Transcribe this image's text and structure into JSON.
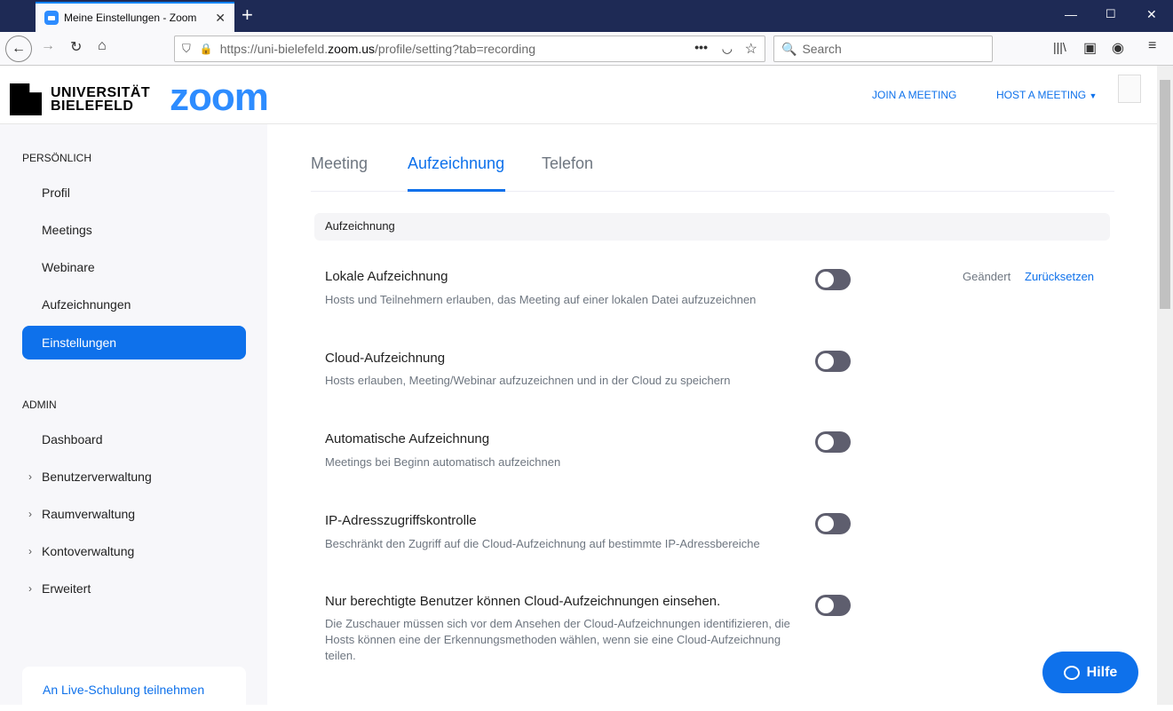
{
  "browser": {
    "tab_title": "Meine Einstellungen - Zoom",
    "url_prefix": "https://uni-bielefeld.",
    "url_domain": "zoom.us",
    "url_path": "/profile/setting?tab=recording",
    "search_placeholder": "Search"
  },
  "header": {
    "uni_line1": "UNIVERSITÄT",
    "uni_line2": "BIELEFELD",
    "zoom_logo": "zoom",
    "join": "JOIN A MEETING",
    "host": "HOST A MEETING"
  },
  "sidebar": {
    "personal_heading": "PERSÖNLICH",
    "personal_items": [
      "Profil",
      "Meetings",
      "Webinare",
      "Aufzeichnungen",
      "Einstellungen"
    ],
    "admin_heading": "ADMIN",
    "admin_items": [
      "Dashboard",
      "Benutzerverwaltung",
      "Raumverwaltung",
      "Kontoverwaltung",
      "Erweitert"
    ],
    "live_training": "An Live-Schulung teilnehmen"
  },
  "tabs": [
    "Meeting",
    "Aufzeichnung",
    "Telefon"
  ],
  "section_title": "Aufzeichnung",
  "settings": [
    {
      "title": "Lokale Aufzeichnung",
      "desc": "Hosts und Teilnehmern erlauben, das Meeting auf einer lokalen Datei aufzuzeichnen",
      "enabled": false
    },
    {
      "title": "Cloud-Aufzeichnung",
      "desc": "Hosts erlauben, Meeting/Webinar aufzuzeichnen und in der Cloud zu speichern",
      "enabled": false
    },
    {
      "title": "Automatische Aufzeichnung",
      "desc": "Meetings bei Beginn automatisch aufzeichnen",
      "enabled": false
    },
    {
      "title": "IP-Adresszugriffskontrolle",
      "desc": "Beschränkt den Zugriff auf die Cloud-Aufzeichnung auf bestimmte IP-Adressbereiche",
      "enabled": false
    },
    {
      "title": "Nur berechtigte Benutzer können Cloud-Aufzeichnungen einsehen.",
      "desc": "Die Zuschauer müssen sich vor dem Ansehen der Cloud-Aufzeichnungen identifizieren, die Hosts können eine der Erkennungsmethoden wählen, wenn sie eine Cloud-Aufzeichnung teilen.",
      "enabled": false
    }
  ],
  "changed_label": "Geändert",
  "reset_label": "Zurücksetzen",
  "help_label": "Hilfe"
}
